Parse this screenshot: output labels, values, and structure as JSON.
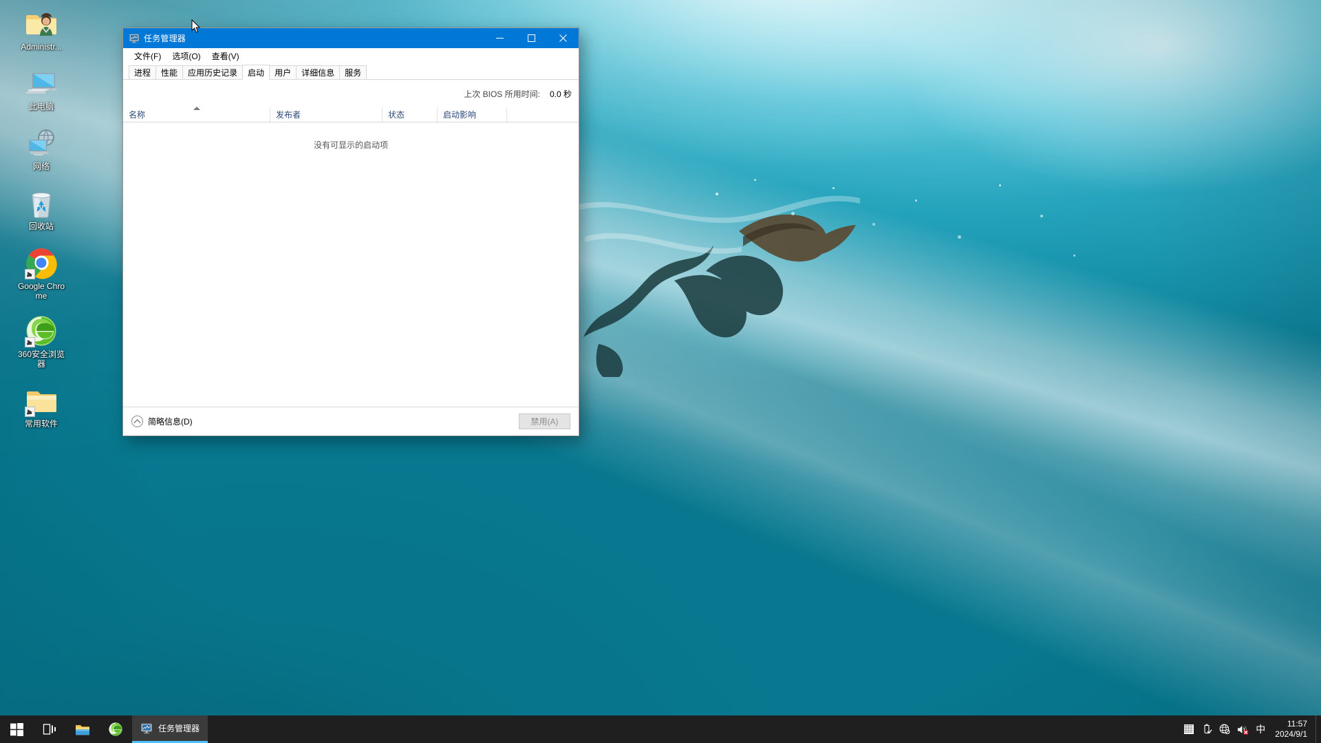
{
  "desktop": {
    "icons": [
      {
        "name": "Administr...",
        "icon": "user-folder-icon",
        "shortcut": false
      },
      {
        "name": "此电脑",
        "icon": "this-pc-icon",
        "shortcut": false
      },
      {
        "name": "网络",
        "icon": "network-icon",
        "shortcut": false
      },
      {
        "name": "回收站",
        "icon": "recycle-bin-icon",
        "shortcut": false
      },
      {
        "name": "Google Chrome",
        "icon": "chrome-icon",
        "shortcut": true
      },
      {
        "name": "360安全浏览器",
        "icon": "360-browser-icon",
        "shortcut": true
      },
      {
        "name": "常用软件",
        "icon": "folder-icon",
        "shortcut": true
      }
    ]
  },
  "window": {
    "title": "任务管理器",
    "icon": "task-manager-icon",
    "accent_color": "#0078d7",
    "controls": {
      "minimize": "最小化",
      "maximize": "最大化",
      "close": "关闭"
    },
    "menu": [
      {
        "label": "文件(F)"
      },
      {
        "label": "选项(O)"
      },
      {
        "label": "查看(V)"
      }
    ],
    "tabs": [
      {
        "label": "进程",
        "active": false
      },
      {
        "label": "性能",
        "active": false
      },
      {
        "label": "应用历史记录",
        "active": false
      },
      {
        "label": "启动",
        "active": true
      },
      {
        "label": "用户",
        "active": false
      },
      {
        "label": "详细信息",
        "active": false
      },
      {
        "label": "服务",
        "active": false
      }
    ],
    "bios": {
      "label": "上次 BIOS 所用时间:",
      "value": "0.0 秒"
    },
    "columns": [
      {
        "label": "名称",
        "sorted": true,
        "sort_dir": "asc"
      },
      {
        "label": "发布者",
        "sorted": false
      },
      {
        "label": "状态",
        "sorted": false
      },
      {
        "label": "启动影响",
        "sorted": false
      }
    ],
    "rows": [],
    "empty_message": "没有可显示的启动项",
    "statusbar": {
      "fewer_details": "简略信息(D)",
      "disable_button": "禁用(A)",
      "disable_enabled": false
    }
  },
  "taskbar": {
    "start": "开始",
    "taskview": "任务视图",
    "pinned": [
      {
        "name": "文件资源管理器",
        "icon": "file-explorer-icon"
      },
      {
        "name": "360安全浏览器",
        "icon": "360-browser-icon"
      }
    ],
    "open_apps": [
      {
        "name": "任务管理器",
        "icon": "task-manager-icon",
        "active": true
      }
    ],
    "tray": [
      {
        "name": "输入法设置",
        "icon": "grid-icon"
      },
      {
        "name": "安全删除硬件",
        "icon": "usb-icon"
      },
      {
        "name": "网络",
        "icon": "network-disconnected-icon"
      },
      {
        "name": "音量",
        "icon": "speaker-muted-icon"
      }
    ],
    "ime": "中",
    "clock": {
      "time": "11:57",
      "date": "2024/9/1"
    }
  }
}
